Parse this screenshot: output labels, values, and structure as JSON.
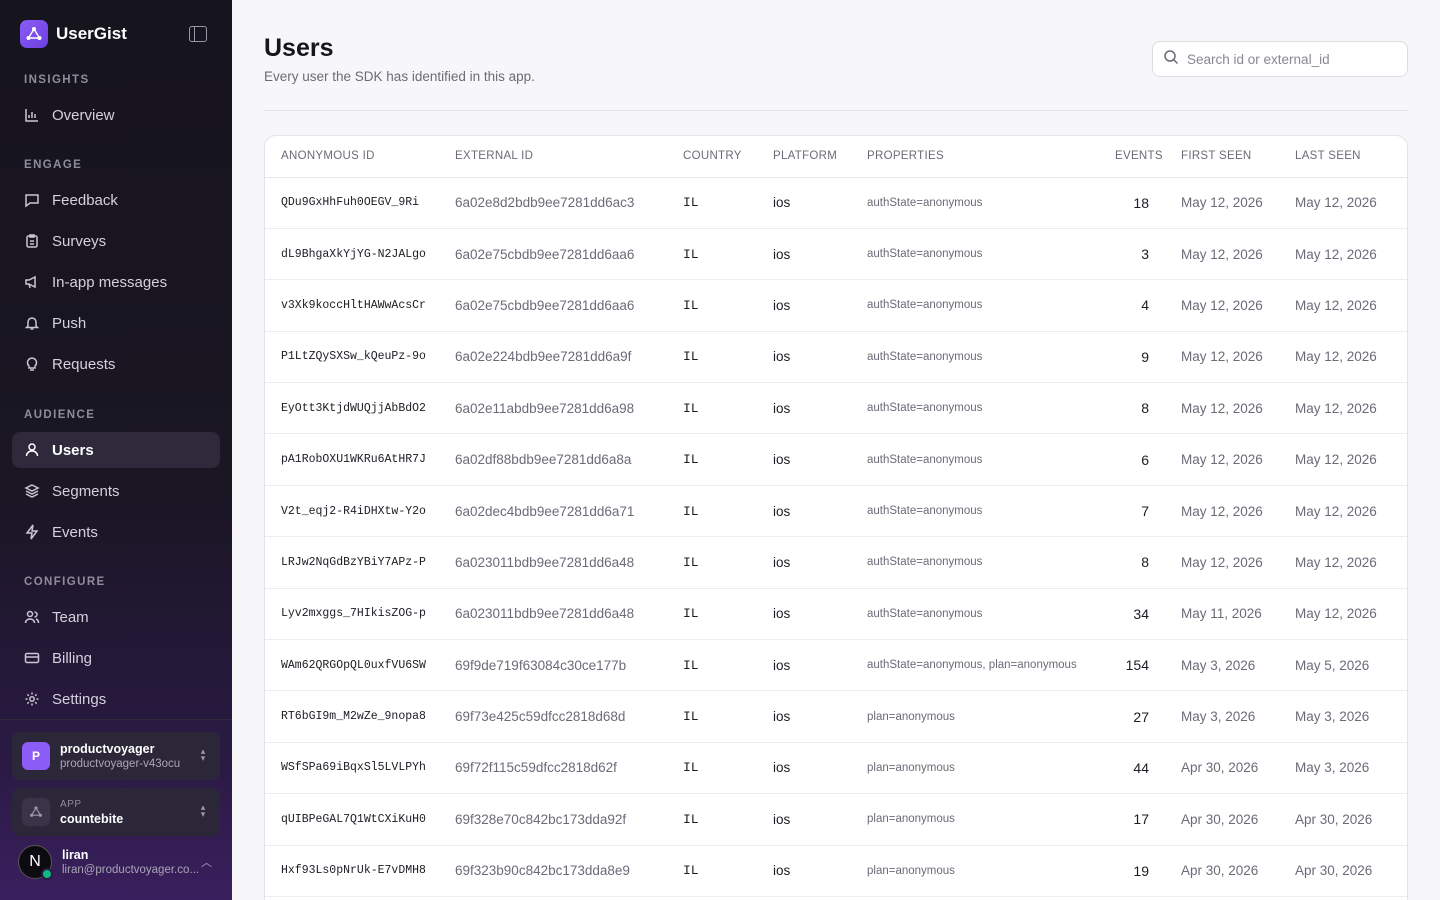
{
  "brand": {
    "name": "UserGist"
  },
  "sidebar": {
    "sections": {
      "insights": "INSIGHTS",
      "engage": "ENGAGE",
      "audience": "AUDIENCE",
      "configure": "CONFIGURE"
    },
    "items": {
      "overview": "Overview",
      "feedback": "Feedback",
      "surveys": "Surveys",
      "inapp": "In-app messages",
      "push": "Push",
      "requests": "Requests",
      "users": "Users",
      "segments": "Segments",
      "events": "Events",
      "team": "Team",
      "billing": "Billing",
      "settings": "Settings"
    },
    "workspace": {
      "initial": "P",
      "name": "productvoyager",
      "slug": "productvoyager-v43ocu"
    },
    "app": {
      "label": "APP",
      "name": "countebite"
    },
    "user": {
      "initial": "N",
      "name": "liran",
      "email": "liran@productvoyager.co..."
    }
  },
  "header": {
    "title": "Users",
    "subtitle": "Every user the SDK has identified in this app.",
    "search_placeholder": "Search id or external_id"
  },
  "table": {
    "columns": {
      "anon": "ANONYMOUS ID",
      "ext": "EXTERNAL ID",
      "country": "COUNTRY",
      "platform": "PLATFORM",
      "props": "PROPERTIES",
      "events": "EVENTS",
      "first": "FIRST SEEN",
      "last": "LAST SEEN"
    },
    "rows": [
      {
        "anon": "QDu9GxHhFuh0OEGV_9Ri",
        "ext": "6a02e8d2bdb9ee7281dd6ac3",
        "country": "IL",
        "platform": "ios",
        "props": "authState=anonymous",
        "events": "18",
        "first": "May 12, 2026",
        "last": "May 12, 2026"
      },
      {
        "anon": "dL9BhgaXkYjYG-N2JALgo",
        "ext": "6a02e75cbdb9ee7281dd6aa6",
        "country": "IL",
        "platform": "ios",
        "props": "authState=anonymous",
        "events": "3",
        "first": "May 12, 2026",
        "last": "May 12, 2026"
      },
      {
        "anon": "v3Xk9koccHltHAWwAcsCr",
        "ext": "6a02e75cbdb9ee7281dd6aa6",
        "country": "IL",
        "platform": "ios",
        "props": "authState=anonymous",
        "events": "4",
        "first": "May 12, 2026",
        "last": "May 12, 2026"
      },
      {
        "anon": "P1LtZQySXSw_kQeuPz-9o",
        "ext": "6a02e224bdb9ee7281dd6a9f",
        "country": "IL",
        "platform": "ios",
        "props": "authState=anonymous",
        "events": "9",
        "first": "May 12, 2026",
        "last": "May 12, 2026"
      },
      {
        "anon": "EyOtt3KtjdWUQjjAbBdO2",
        "ext": "6a02e11abdb9ee7281dd6a98",
        "country": "IL",
        "platform": "ios",
        "props": "authState=anonymous",
        "events": "8",
        "first": "May 12, 2026",
        "last": "May 12, 2026"
      },
      {
        "anon": "pA1RobOXU1WKRu6AtHR7J",
        "ext": "6a02df88bdb9ee7281dd6a8a",
        "country": "IL",
        "platform": "ios",
        "props": "authState=anonymous",
        "events": "6",
        "first": "May 12, 2026",
        "last": "May 12, 2026"
      },
      {
        "anon": "V2t_eqj2-R4iDHXtw-Y2o",
        "ext": "6a02dec4bdb9ee7281dd6a71",
        "country": "IL",
        "platform": "ios",
        "props": "authState=anonymous",
        "events": "7",
        "first": "May 12, 2026",
        "last": "May 12, 2026"
      },
      {
        "anon": "LRJw2NqGdBzYBiY7APz-P",
        "ext": "6a023011bdb9ee7281dd6a48",
        "country": "IL",
        "platform": "ios",
        "props": "authState=anonymous",
        "events": "8",
        "first": "May 12, 2026",
        "last": "May 12, 2026"
      },
      {
        "anon": "Lyv2mxggs_7HIkisZOG-p",
        "ext": "6a023011bdb9ee7281dd6a48",
        "country": "IL",
        "platform": "ios",
        "props": "authState=anonymous",
        "events": "34",
        "first": "May 11, 2026",
        "last": "May 12, 2026"
      },
      {
        "anon": "WAm62QRGOpQL0uxfVU6SW",
        "ext": "69f9de719f63084c30ce177b",
        "country": "IL",
        "platform": "ios",
        "props": "authState=anonymous, plan=anonymous",
        "events": "154",
        "first": "May 3, 2026",
        "last": "May 5, 2026"
      },
      {
        "anon": "RT6bGI9m_M2wZe_9nopa8",
        "ext": "69f73e425c59dfcc2818d68d",
        "country": "IL",
        "platform": "ios",
        "props": "plan=anonymous",
        "events": "27",
        "first": "May 3, 2026",
        "last": "May 3, 2026"
      },
      {
        "anon": "WSfSPa69iBqxSl5LVLPYh",
        "ext": "69f72f115c59dfcc2818d62f",
        "country": "IL",
        "platform": "ios",
        "props": "plan=anonymous",
        "events": "44",
        "first": "Apr 30, 2026",
        "last": "May 3, 2026"
      },
      {
        "anon": "qUIBPeGAL7Q1WtCXiKuH0",
        "ext": "69f328e70c842bc173dda92f",
        "country": "IL",
        "platform": "ios",
        "props": "plan=anonymous",
        "events": "17",
        "first": "Apr 30, 2026",
        "last": "Apr 30, 2026"
      },
      {
        "anon": "Hxf93Ls0pNrUk-E7vDMH8",
        "ext": "69f323b90c842bc173dda8e9",
        "country": "IL",
        "platform": "ios",
        "props": "plan=anonymous",
        "events": "19",
        "first": "Apr 30, 2026",
        "last": "Apr 30, 2026"
      }
    ]
  }
}
